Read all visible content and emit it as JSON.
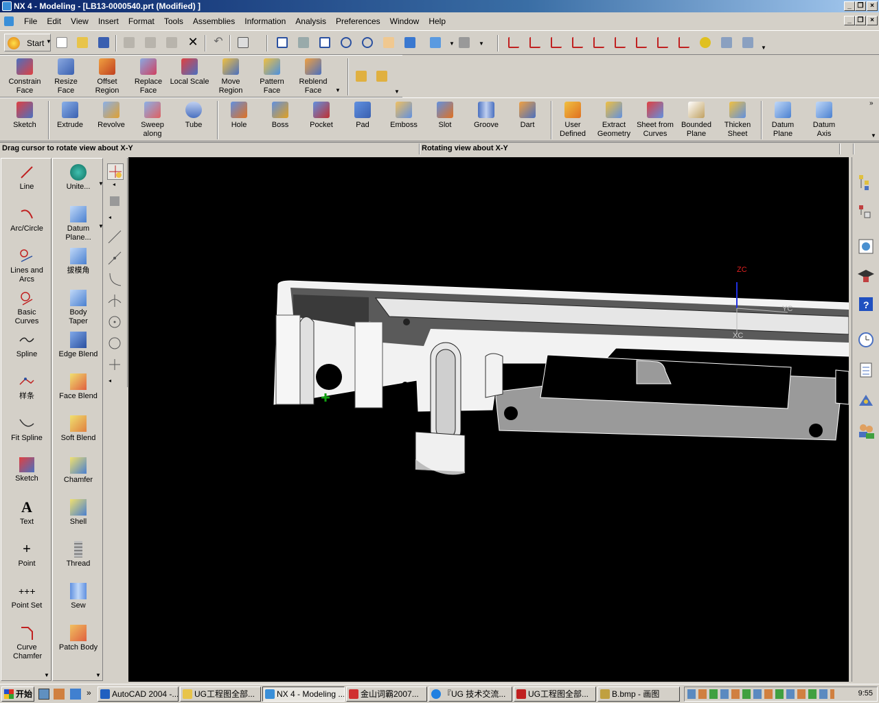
{
  "window": {
    "title": "NX 4 - Modeling - [LB13-0000540.prt (Modified) ]"
  },
  "menu": {
    "items": [
      "File",
      "Edit",
      "View",
      "Insert",
      "Format",
      "Tools",
      "Assemblies",
      "Information",
      "Analysis",
      "Preferences",
      "Window",
      "Help"
    ]
  },
  "standard_toolbar": {
    "start_label": "Start"
  },
  "feature_ops_toolbar": {
    "items": [
      "Constrain Face",
      "Resize Face",
      "Offset Region",
      "Replace Face",
      "Local Scale",
      "Move Region",
      "Pattern Face",
      "Reblend Face"
    ]
  },
  "form_feature_toolbar": {
    "items": [
      "Sketch",
      "Extrude",
      "Revolve",
      "Sweep along",
      "Tube",
      "Hole",
      "Boss",
      "Pocket",
      "Pad",
      "Emboss",
      "Slot",
      "Groove",
      "Dart",
      "User Defined",
      "Extract Geometry",
      "Sheet from Curves",
      "Bounded Plane",
      "Thicken Sheet",
      "Datum Plane",
      "Datum Axis"
    ]
  },
  "status": {
    "prompt": "Drag cursor to rotate view about X-Y",
    "message": "Rotating view about X-Y"
  },
  "curve_palette": {
    "items": [
      "Line",
      "Arc/Circle",
      "Lines and Arcs",
      "Basic Curves",
      "Spline",
      "样条",
      "Fit Spline",
      "Sketch",
      "Text",
      "Point",
      "Point Set",
      "Curve Chamfer"
    ]
  },
  "feature_palette": {
    "items": [
      "Unite...",
      "Datum Plane...",
      "拔模角",
      "Body Taper",
      "Edge Blend",
      "Face Blend",
      "Soft Blend",
      "Chamfer",
      "Shell",
      "Thread",
      "Sew",
      "Patch Body"
    ]
  },
  "viewport": {
    "axis_zc": "ZC",
    "axis_xc": "XC",
    "axis_yc": "YC"
  },
  "taskbar": {
    "start": "开始",
    "tasks": [
      "AutoCAD 2004 -...",
      "UG工程图全部...",
      "NX 4 - Modeling ...",
      "金山词霸2007...",
      "『UG 技术交流...",
      "UG工程图全部...",
      "B.bmp - 画图"
    ],
    "clock": "9:55"
  }
}
